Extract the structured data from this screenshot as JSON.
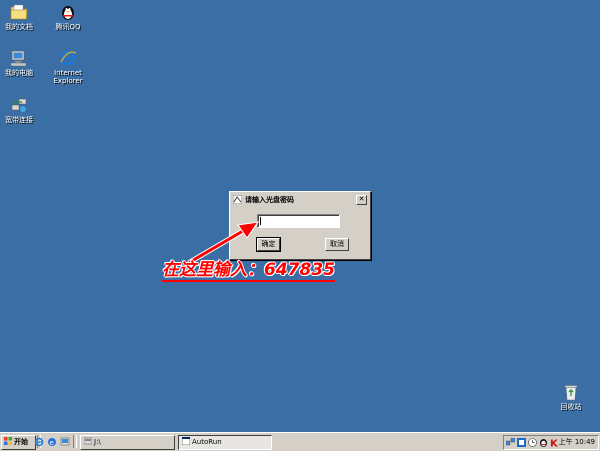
{
  "desktop": {
    "icons": [
      {
        "label": "我的文档"
      },
      {
        "label": "腾讯QQ"
      },
      {
        "label": "我的电脑"
      },
      {
        "label": "Internet\nExplorer"
      },
      {
        "label": "宽带连接"
      },
      {
        "label": "回收站"
      }
    ]
  },
  "dialog": {
    "title": "请输入光盘密码",
    "close_label": "✕",
    "password_value": "",
    "ok_label": "确定",
    "cancel_label": "取消"
  },
  "annotation": {
    "text": "在这里输入：647835",
    "color": "#ff0000"
  },
  "taskbar": {
    "start_label": "开始",
    "address_label": "J:\\",
    "task_label": "AutoRun",
    "tray_ampm": "上午",
    "tray_time": "10:49"
  },
  "colors": {
    "desktop": "#3a6ea5",
    "window_face": "#d4d0c8"
  }
}
